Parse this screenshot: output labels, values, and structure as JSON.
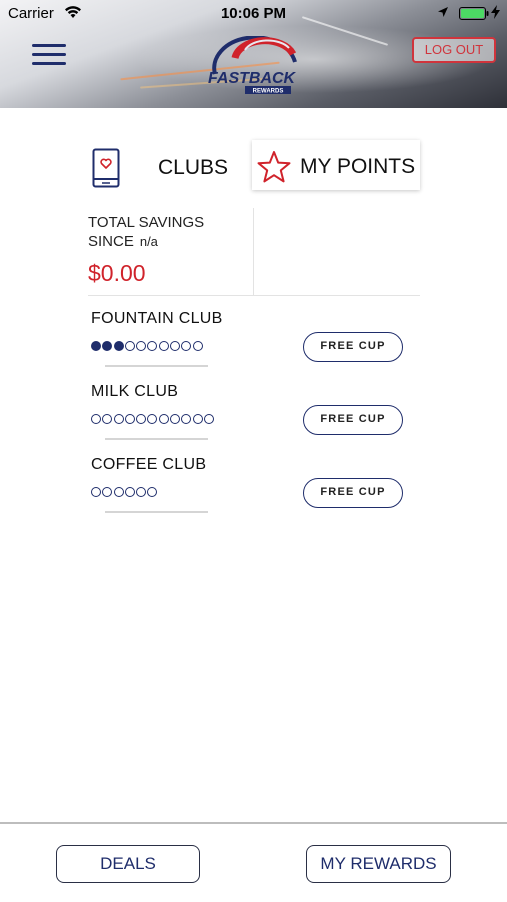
{
  "status_bar": {
    "carrier": "Carrier",
    "time": "10:06 PM"
  },
  "header": {
    "logo_text": "FASTBACK",
    "logo_subtext": "REWARDS",
    "logout_label": "LOG OUT"
  },
  "tabs": {
    "clubs_label": "CLUBS",
    "points_label": "MY POINTS"
  },
  "savings": {
    "line1": "TOTAL SAVINGS",
    "line2": "SINCE",
    "since_value": "n/a",
    "amount": "$0.00"
  },
  "clubs": [
    {
      "name": "FOUNTAIN CLUB",
      "filled": 3,
      "total": 10,
      "button_label": "FREE CUP"
    },
    {
      "name": "MILK CLUB",
      "filled": 0,
      "total": 11,
      "button_label": "FREE CUP"
    },
    {
      "name": "COFFEE CLUB",
      "filled": 0,
      "total": 6,
      "button_label": "FREE CUP"
    }
  ],
  "bottom_bar": {
    "deals_label": "DEALS",
    "rewards_label": "MY REWARDS"
  },
  "colors": {
    "navy": "#1f2d6b",
    "red": "#d0232b",
    "battery_green": "#4cd964"
  }
}
